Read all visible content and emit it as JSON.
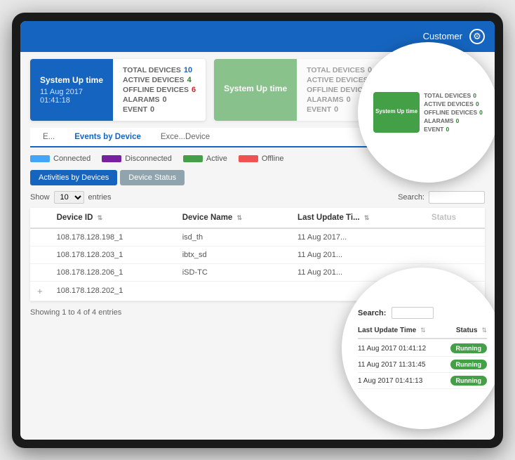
{
  "header": {
    "username": "Customer",
    "settings_label": "settings"
  },
  "card1": {
    "left_title": "System Up time",
    "date": "11 Aug 2017",
    "time": "01:41:18",
    "total_devices_label": "TOTAL DEVICES",
    "total_devices_val": "10",
    "active_devices_label": "ACTIVE DEVICES",
    "active_devices_val": "4",
    "offline_devices_label": "OFFLINE DEVICES",
    "offline_devices_val": "6",
    "alarms_label": "ALARAMS",
    "alarms_val": "0",
    "event_label": "EVENT",
    "event_val": "0"
  },
  "card2": {
    "left_title": "System Up time",
    "total_devices_label": "TOTAL DEVICES",
    "total_devices_val": "0",
    "active_devices_label": "ACTIVE DEVICES",
    "active_devices_val": "0",
    "offline_devices_label": "OFFLINE DEVICES",
    "offline_devices_val": "0",
    "alarms_label": "ALARAMS",
    "alarms_val": "0",
    "event_label": "EVENT",
    "event_val": "0"
  },
  "tabs": {
    "tab1": "E...",
    "tab2": "Events by Device",
    "tab3": "Exce...Device"
  },
  "legend": {
    "connected": "Connected",
    "disconnected": "Disconnected",
    "active": "Active",
    "offline": "Offline"
  },
  "sub_tabs": {
    "tab1": "Activities by Devices",
    "tab2": "Device Status"
  },
  "table_controls": {
    "show_label": "Show",
    "entries_val": "10",
    "entries_label": "entries",
    "search_label": "Search:"
  },
  "table": {
    "headers": [
      "Device ID",
      "Device Name",
      "Last Update Ti...",
      "Status"
    ],
    "rows": [
      {
        "device_id": "108.178.128.198_1",
        "device_name": "isd_th",
        "last_update": "11 Aug 2017...",
        "status": "Running"
      },
      {
        "device_id": "108.178.128.203_1",
        "device_name": "ibtx_sd",
        "last_update": "11 Aug 201...",
        "status": "Running"
      },
      {
        "device_id": "108.178.128.206_1",
        "device_name": "iSD-TC",
        "last_update": "11 Aug 201...",
        "status": "Running"
      },
      {
        "device_id": "108.178.128.202_1",
        "device_name": "",
        "last_update": "",
        "status": ""
      }
    ]
  },
  "footer": {
    "showing": "Showing 1 to 4 of 4 entries"
  },
  "circle_bottom": {
    "search_label": "Search:",
    "col_last_update": "Last Update Time",
    "col_status": "Status",
    "rows": [
      {
        "date": "11 Aug 2017 01:41:12",
        "status": "Running"
      },
      {
        "date": "11 Aug 2017 11:31:45",
        "status": "Running"
      },
      {
        "date": "1 Aug 2017 01:41:13",
        "status": "Running"
      }
    ]
  }
}
